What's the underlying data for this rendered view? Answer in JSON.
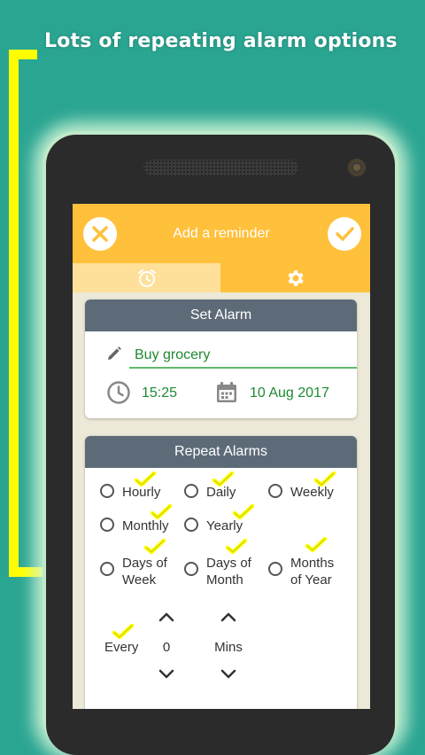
{
  "promo": {
    "title": "Lots of repeating alarm options"
  },
  "header": {
    "title": "Add a reminder"
  },
  "tabs": [
    {
      "name": "alarm",
      "icon": "alarm-clock-icon",
      "active": true
    },
    {
      "name": "settings",
      "icon": "gear-icon",
      "active": false
    }
  ],
  "set_alarm": {
    "title": "Set Alarm",
    "reminder_title": "Buy grocery",
    "time": "15:25",
    "date": "10 Aug 2017"
  },
  "repeat_alarms": {
    "title": "Repeat Alarms",
    "options": [
      "Hourly",
      "Daily",
      "Weekly",
      "Monthly",
      "Yearly",
      "Days of\nWeek",
      "Days of\nMonth",
      "Months\nof Year"
    ],
    "every_label": "Every",
    "count_value": "0",
    "unit_label": "Mins"
  },
  "colors": {
    "background": "#2aa592",
    "header": "#ffc03b",
    "card_header": "#5d6b78",
    "accent_text": "#1e8a33",
    "highlight": "#ffff00"
  }
}
